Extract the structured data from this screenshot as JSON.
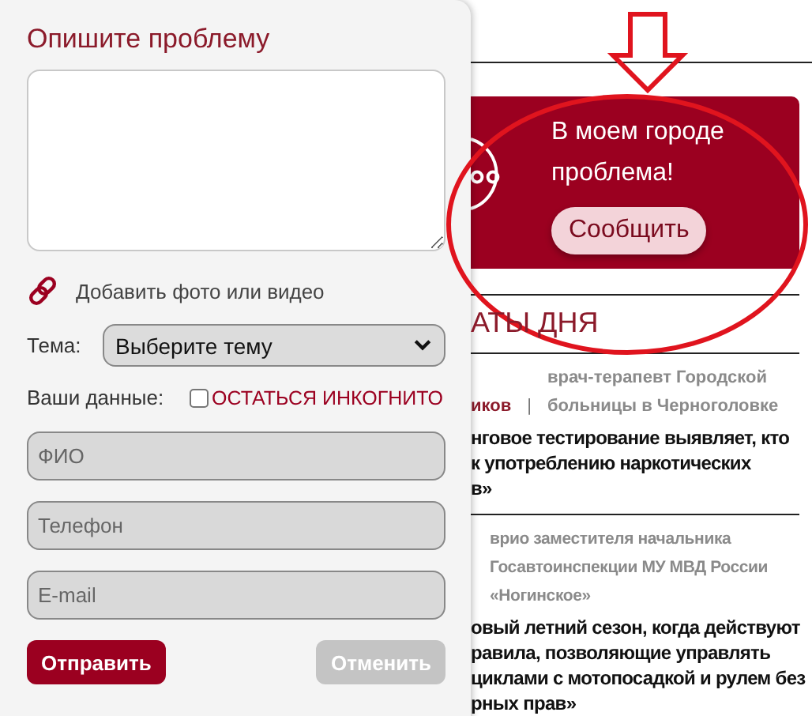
{
  "form": {
    "title": "Опишите проблему",
    "attach_label": "Добавить фото или видео",
    "topic": {
      "label": "Тема:",
      "value": "Выберите тему"
    },
    "your_data_label": "Ваши данные:",
    "incognito": {
      "label": "ОСТАТЬСЯ ИНКОГНИТО",
      "checked": false
    },
    "fields": [
      {
        "placeholder": "ФИО"
      },
      {
        "placeholder": "Телефон"
      },
      {
        "placeholder": "E-mail"
      }
    ],
    "buttons": [
      {
        "label": "Отправить",
        "kind": "primary"
      },
      {
        "label": "Отменить",
        "kind": "secondary"
      }
    ]
  },
  "banner": {
    "text": "В моем городе проблема!",
    "button": "Сообщить"
  },
  "section_title": "АТЫ ДНЯ",
  "articles": [
    {
      "author": "иков",
      "separator": "|",
      "caption": "врач-терапевт Городской больницы в Черноголовке",
      "title_lines": [
        "нговое тестирование выявляет, кто",
        "к употреблению наркотических",
        "в»"
      ]
    },
    {
      "caption": "врио заместителя начальника Госавтоинспекции МУ МВД России «Ногинское»",
      "title_lines": [
        "овый летний сезон, когда действуют",
        "равила, позволяющие управлять",
        "циклами с мотопосадкой и рулем без",
        "рных прав»"
      ]
    }
  ]
}
